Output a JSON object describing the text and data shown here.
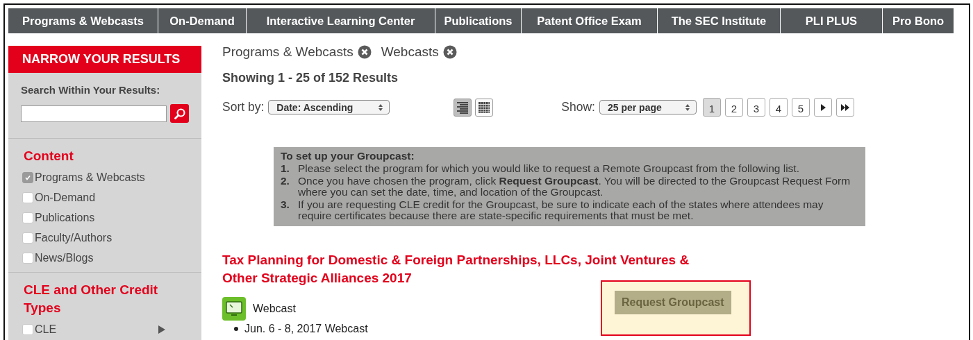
{
  "nav": [
    {
      "label": "Programs & Webcasts"
    },
    {
      "label": "On-Demand"
    },
    {
      "label": "Interactive Learning Center"
    },
    {
      "label": "Publications"
    },
    {
      "label": "Patent Office Exam"
    },
    {
      "label": "The SEC Institute"
    },
    {
      "label": "PLI PLUS"
    },
    {
      "label": "Pro Bono"
    }
  ],
  "sidebar": {
    "header": "NARROW YOUR RESULTS",
    "search_label": "Search Within Your Results:",
    "sections": [
      {
        "title": "Content",
        "items": [
          {
            "label": "Programs & Webcasts",
            "checked": true,
            "expandable": false
          },
          {
            "label": "On-Demand",
            "checked": false,
            "expandable": false
          },
          {
            "label": "Publications",
            "checked": false,
            "expandable": false
          },
          {
            "label": "Faculty/Authors",
            "checked": false,
            "expandable": false
          },
          {
            "label": "News/Blogs",
            "checked": false,
            "expandable": false
          }
        ]
      },
      {
        "title": "CLE and Other Credit Types",
        "items": [
          {
            "label": "CLE",
            "checked": false,
            "expandable": true
          }
        ]
      }
    ]
  },
  "filters": [
    {
      "label": "Programs & Webcasts"
    },
    {
      "label": "Webcasts"
    }
  ],
  "results_count": "Showing 1 - 25 of 152 Results",
  "sort": {
    "label": "Sort by:",
    "value": "Date: Ascending"
  },
  "view_modes": [
    {
      "kind": "list",
      "selected": true
    },
    {
      "kind": "grid",
      "selected": false
    }
  ],
  "show": {
    "label": "Show:",
    "value": "25 per page"
  },
  "pages": [
    {
      "label": "1",
      "selected": true
    },
    {
      "label": "2",
      "selected": false
    },
    {
      "label": "3",
      "selected": false
    },
    {
      "label": "4",
      "selected": false
    },
    {
      "label": "5",
      "selected": false
    }
  ],
  "page_nav": [
    {
      "kind": "next"
    },
    {
      "kind": "last"
    }
  ],
  "instructions": {
    "title": "To set up your Groupcast:",
    "steps": [
      {
        "number": "1.",
        "text": "Please select the program for which you would like to request a Remote Groupcast from the following list."
      },
      {
        "number": "2.",
        "text": "Once you have chosen the program, click **Request Groupcast**. You will be directed to the Groupcast Request Form where you can set the date, time, and location of the Groupcast."
      },
      {
        "number": "3.",
        "text": "If you are requesting CLE credit for the Groupcast, be sure to indicate each of the states where attendees may require certificates because there are state-specific requirements that must be met."
      }
    ]
  },
  "results": [
    {
      "title": "Tax Planning for Domestic & Foreign Partnerships, LLCs, Joint Ventures & Other Strategic Alliances 2017",
      "format": "Webcast",
      "dates": [
        "Jun. 6 - 8, 2017 Webcast"
      ],
      "action": "Request Groupcast"
    }
  ]
}
